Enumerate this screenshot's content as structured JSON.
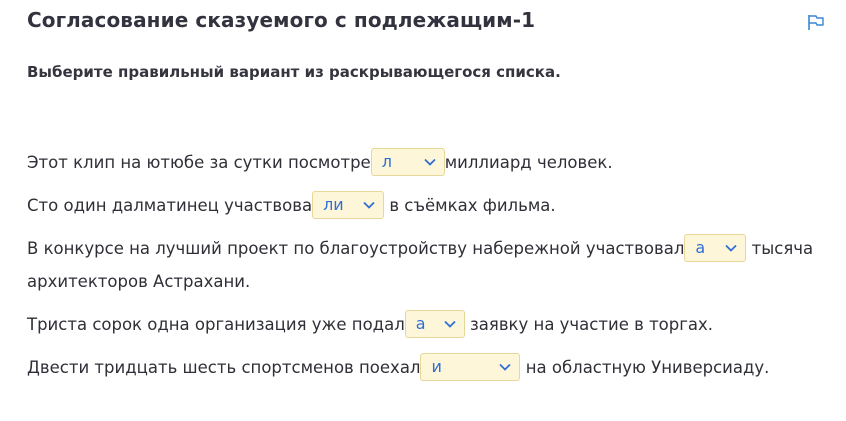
{
  "header": {
    "title": "Согласование сказуемого с подлежащим-1",
    "flag_icon": "flag-icon"
  },
  "instruction": "Выберите правильный вариант из раскрывающегося списка.",
  "accent_color": "#2f6fd6",
  "dropdown_bg": "#fdf6d8",
  "sentences": [
    {
      "before": "Этот клип на ютюбе за сутки посмотре",
      "selected": "л",
      "after": "миллиард человек."
    },
    {
      "before": "Сто один далматинец участвова",
      "selected": "ли",
      "after": "в съёмках фильма."
    },
    {
      "before": "В конкурсе на лучший проект по благоустройству набережной участвовал",
      "selected": "а",
      "after": "тысяча архитекторов Астрахани."
    },
    {
      "before": "Триста сорок одна организация уже подал",
      "selected": "а",
      "after": "заявку на участие в торгах."
    },
    {
      "before": "Двести тридцать шесть спортсменов поехал",
      "selected": "и",
      "after": "на областную Универсиаду."
    }
  ]
}
